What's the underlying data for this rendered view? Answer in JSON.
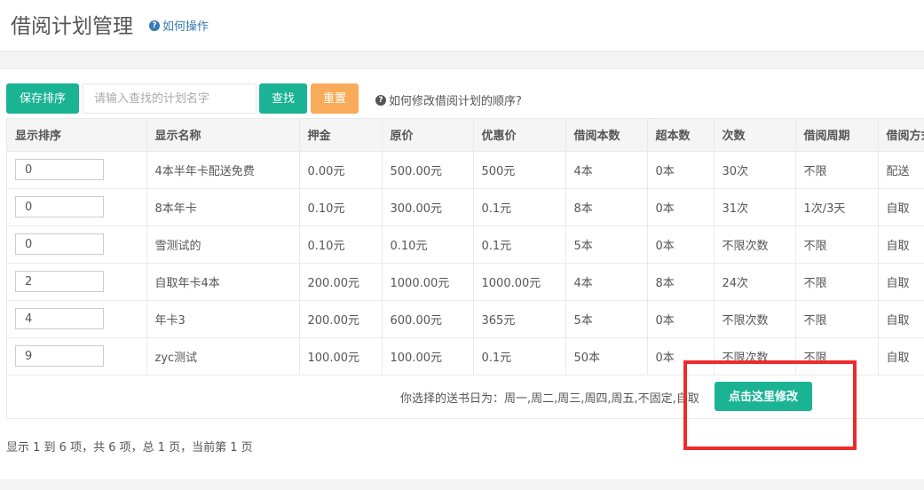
{
  "header": {
    "title": "借阅计划管理",
    "help_link": "如何操作"
  },
  "toolbar": {
    "save_label": "保存排序",
    "search_placeholder": "请输入查找的计划名字",
    "search_label": "查找",
    "reset_label": "重置",
    "order_help": "如何修改借阅计划的顺序?"
  },
  "table": {
    "columns": [
      "显示排序",
      "显示名称",
      "押金",
      "原价",
      "优惠价",
      "借阅本数",
      "超本数",
      "次数",
      "借阅周期",
      "借阅方式"
    ],
    "rows": [
      {
        "order": "0",
        "name": "4本半年卡配送免费",
        "deposit": "0.00元",
        "price": "500.00元",
        "sale": "500元",
        "books": "4本",
        "extra": "0本",
        "times": "30次",
        "cycle": "不限",
        "method": "配送"
      },
      {
        "order": "0",
        "name": "8本年卡",
        "deposit": "0.10元",
        "price": "300.00元",
        "sale": "0.1元",
        "books": "8本",
        "extra": "0本",
        "times": "31次",
        "cycle": "1次/3天",
        "method": "自取"
      },
      {
        "order": "0",
        "name": "雪测试的",
        "deposit": "0.10元",
        "price": "0.10元",
        "sale": "0.1元",
        "books": "5本",
        "extra": "0本",
        "times": "不限次数",
        "cycle": "不限",
        "method": "自取"
      },
      {
        "order": "2",
        "name": "自取年卡4本",
        "deposit": "200.00元",
        "price": "1000.00元",
        "sale": "1000.00元",
        "books": "4本",
        "extra": "8本",
        "times": "24次",
        "cycle": "不限",
        "method": "自取"
      },
      {
        "order": "4",
        "name": "年卡3",
        "deposit": "200.00元",
        "price": "600.00元",
        "sale": "365元",
        "books": "5本",
        "extra": "0本",
        "times": "不限次数",
        "cycle": "不限",
        "method": "自取"
      },
      {
        "order": "9",
        "name": "zyc测试",
        "deposit": "100.00元",
        "price": "100.00元",
        "sale": "0.1元",
        "books": "50本",
        "extra": "0本",
        "times": "不限次数",
        "cycle": "不限",
        "method": "自取"
      }
    ],
    "delivery_text": "你选择的送书日为：周一,周二,周三,周四,周五,不固定,自取",
    "modify_label": "点击这里修改"
  },
  "pagination": {
    "info": "显示 1 到 6 项，共 6 项，总 1 页，当前第 1 页"
  },
  "colors": {
    "primary": "#1ab394",
    "warning": "#f8ac59",
    "link": "#337ab7",
    "highlight": "#ee2b2b"
  },
  "icons": {
    "help": "question-circle-icon"
  }
}
